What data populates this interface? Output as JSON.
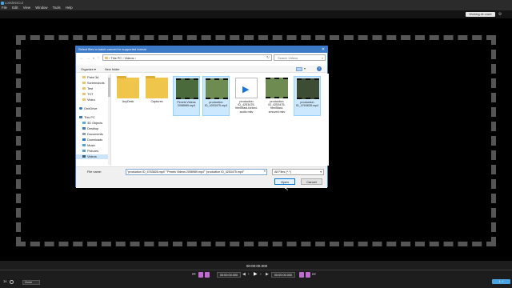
{
  "window": {
    "title": "LosslessCut"
  },
  "menu": [
    "File",
    "Edit",
    "View",
    "Window",
    "Tools",
    "Help"
  ],
  "topbar": {
    "working_dir_label": "Working dir unset"
  },
  "dialog": {
    "title": "Select files to batch convert to supported format",
    "address": [
      "This PC",
      "Videos"
    ],
    "search_placeholder": "Search Videos",
    "organize_label": "Organize ▾",
    "new_folder_label": "New folder",
    "nav_items": [
      {
        "label": "Paint 3d",
        "icon": "folder-icon"
      },
      {
        "label": "Screenshots",
        "icon": "folder-icon"
      },
      {
        "label": "Test",
        "icon": "folder-icon"
      },
      {
        "label": "TXT",
        "icon": "folder-icon"
      },
      {
        "label": "Video",
        "icon": "folder-icon"
      },
      {
        "label": "OneDrive",
        "icon": "cloud-icon"
      },
      {
        "label": "This PC",
        "icon": "computer-icon"
      },
      {
        "label": "3D Objects",
        "icon": "cube-icon"
      },
      {
        "label": "Desktop",
        "icon": "desktop-icon"
      },
      {
        "label": "Documents",
        "icon": "document-icon"
      },
      {
        "label": "Downloads",
        "icon": "download-icon"
      },
      {
        "label": "Music",
        "icon": "music-icon"
      },
      {
        "label": "Pictures",
        "icon": "picture-icon"
      },
      {
        "label": "Videos",
        "icon": "video-icon"
      }
    ],
    "files": [
      {
        "name": "AnyDesk",
        "kind": "folder",
        "selected": false
      },
      {
        "name": "Captures",
        "kind": "folder",
        "selected": false
      },
      {
        "name": "Pexels Videos 2098989.mp4",
        "kind": "video",
        "selected": true
      },
      {
        "name": "production ID_4253475.mp4",
        "kind": "video",
        "selected": true
      },
      {
        "name": "production ID_4253475-html5fast-forked-audio.mkv",
        "kind": "app",
        "selected": false
      },
      {
        "name": "production ID_4253475-html5fast-smoved.mkv",
        "kind": "video",
        "selected": false
      },
      {
        "name": "production ID_4763828.mp4",
        "kind": "video",
        "selected": true
      }
    ],
    "file_name_label": "File name:",
    "file_name_value": "\"production ID_4763828.mp4\" \"Pexels Videos 2098989.mp4\" \"production ID_4253475.mp4\"",
    "file_type_value": "All Files (*.*)",
    "open_label": "Open",
    "cancel_label": "Cancel"
  },
  "player": {
    "timecode": "00:00:00.000",
    "start_time": "00:00:00.000",
    "end_time": "00:00:00.000",
    "speed": "1x",
    "zoom": "Zoom"
  },
  "colors": {
    "accent": "#4aa3df",
    "dialog_title": "#3c7ac7",
    "marker": "#c06bd0"
  }
}
